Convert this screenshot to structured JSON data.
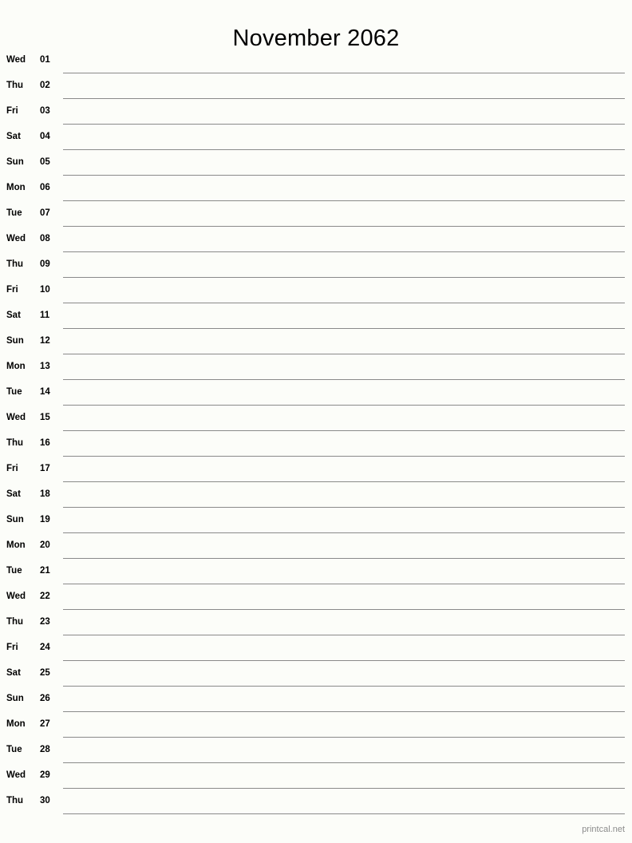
{
  "page": {
    "title": "November 2062",
    "month": "November",
    "year": "2062",
    "background_color": "#fcfdf9",
    "line_color": "#8a8a8a",
    "text_color": "#000000",
    "credit_color": "#8c8c8c"
  },
  "footer": {
    "credit": "printcal.net"
  },
  "days": [
    {
      "weekday": "Wed",
      "number": "01"
    },
    {
      "weekday": "Thu",
      "number": "02"
    },
    {
      "weekday": "Fri",
      "number": "03"
    },
    {
      "weekday": "Sat",
      "number": "04"
    },
    {
      "weekday": "Sun",
      "number": "05"
    },
    {
      "weekday": "Mon",
      "number": "06"
    },
    {
      "weekday": "Tue",
      "number": "07"
    },
    {
      "weekday": "Wed",
      "number": "08"
    },
    {
      "weekday": "Thu",
      "number": "09"
    },
    {
      "weekday": "Fri",
      "number": "10"
    },
    {
      "weekday": "Sat",
      "number": "11"
    },
    {
      "weekday": "Sun",
      "number": "12"
    },
    {
      "weekday": "Mon",
      "number": "13"
    },
    {
      "weekday": "Tue",
      "number": "14"
    },
    {
      "weekday": "Wed",
      "number": "15"
    },
    {
      "weekday": "Thu",
      "number": "16"
    },
    {
      "weekday": "Fri",
      "number": "17"
    },
    {
      "weekday": "Sat",
      "number": "18"
    },
    {
      "weekday": "Sun",
      "number": "19"
    },
    {
      "weekday": "Mon",
      "number": "20"
    },
    {
      "weekday": "Tue",
      "number": "21"
    },
    {
      "weekday": "Wed",
      "number": "22"
    },
    {
      "weekday": "Thu",
      "number": "23"
    },
    {
      "weekday": "Fri",
      "number": "24"
    },
    {
      "weekday": "Sat",
      "number": "25"
    },
    {
      "weekday": "Sun",
      "number": "26"
    },
    {
      "weekday": "Mon",
      "number": "27"
    },
    {
      "weekday": "Tue",
      "number": "28"
    },
    {
      "weekday": "Wed",
      "number": "29"
    },
    {
      "weekday": "Thu",
      "number": "30"
    }
  ]
}
